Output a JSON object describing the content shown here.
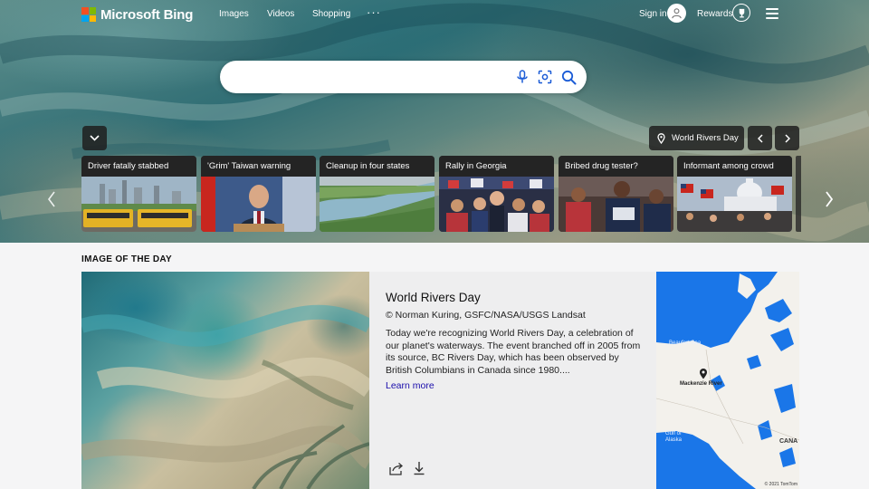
{
  "header": {
    "logo_text": "Microsoft Bing",
    "nav": [
      {
        "label": "Images"
      },
      {
        "label": "Videos"
      },
      {
        "label": "Shopping"
      }
    ],
    "more_label": "···",
    "signin_label": "Sign in",
    "rewards_label": "Rewards"
  },
  "search": {
    "value": "",
    "placeholder": ""
  },
  "carousel": {
    "topic_label": "World Rivers Day",
    "cards": [
      {
        "title": "Driver fatally stabbed"
      },
      {
        "title": "'Grim' Taiwan warning"
      },
      {
        "title": "Cleanup in four states"
      },
      {
        "title": "Rally in Georgia"
      },
      {
        "title": "Bribed drug tester?"
      },
      {
        "title": "Informant among crowd"
      }
    ]
  },
  "iotd": {
    "heading": "IMAGE OF THE DAY",
    "title": "World Rivers Day",
    "credit": "© Norman Kuring, GSFC/NASA/USGS Landsat",
    "description": "Today we're recognizing World Rivers Day, a celebration of our planet's waterways. The event branched off in 2005 from its source, BC Rivers Day, which has been observed by British Columbians in Canada since 1980....",
    "link_label": "Learn more"
  },
  "map": {
    "labels": {
      "beaufort_sea": "Beaufort Sea",
      "mackenzie_river": "Mackenzie River",
      "gulf_of_alaska": "Gulf of Alaska",
      "canada": "CANA"
    },
    "copyright": "© 2021 TomTom"
  },
  "colors": {
    "logo_red": "#f25022",
    "logo_green": "#7fba00",
    "logo_blue": "#00a4ef",
    "logo_yellow": "#ffb900",
    "link": "#1a0dab",
    "water": "#1a76e8"
  }
}
